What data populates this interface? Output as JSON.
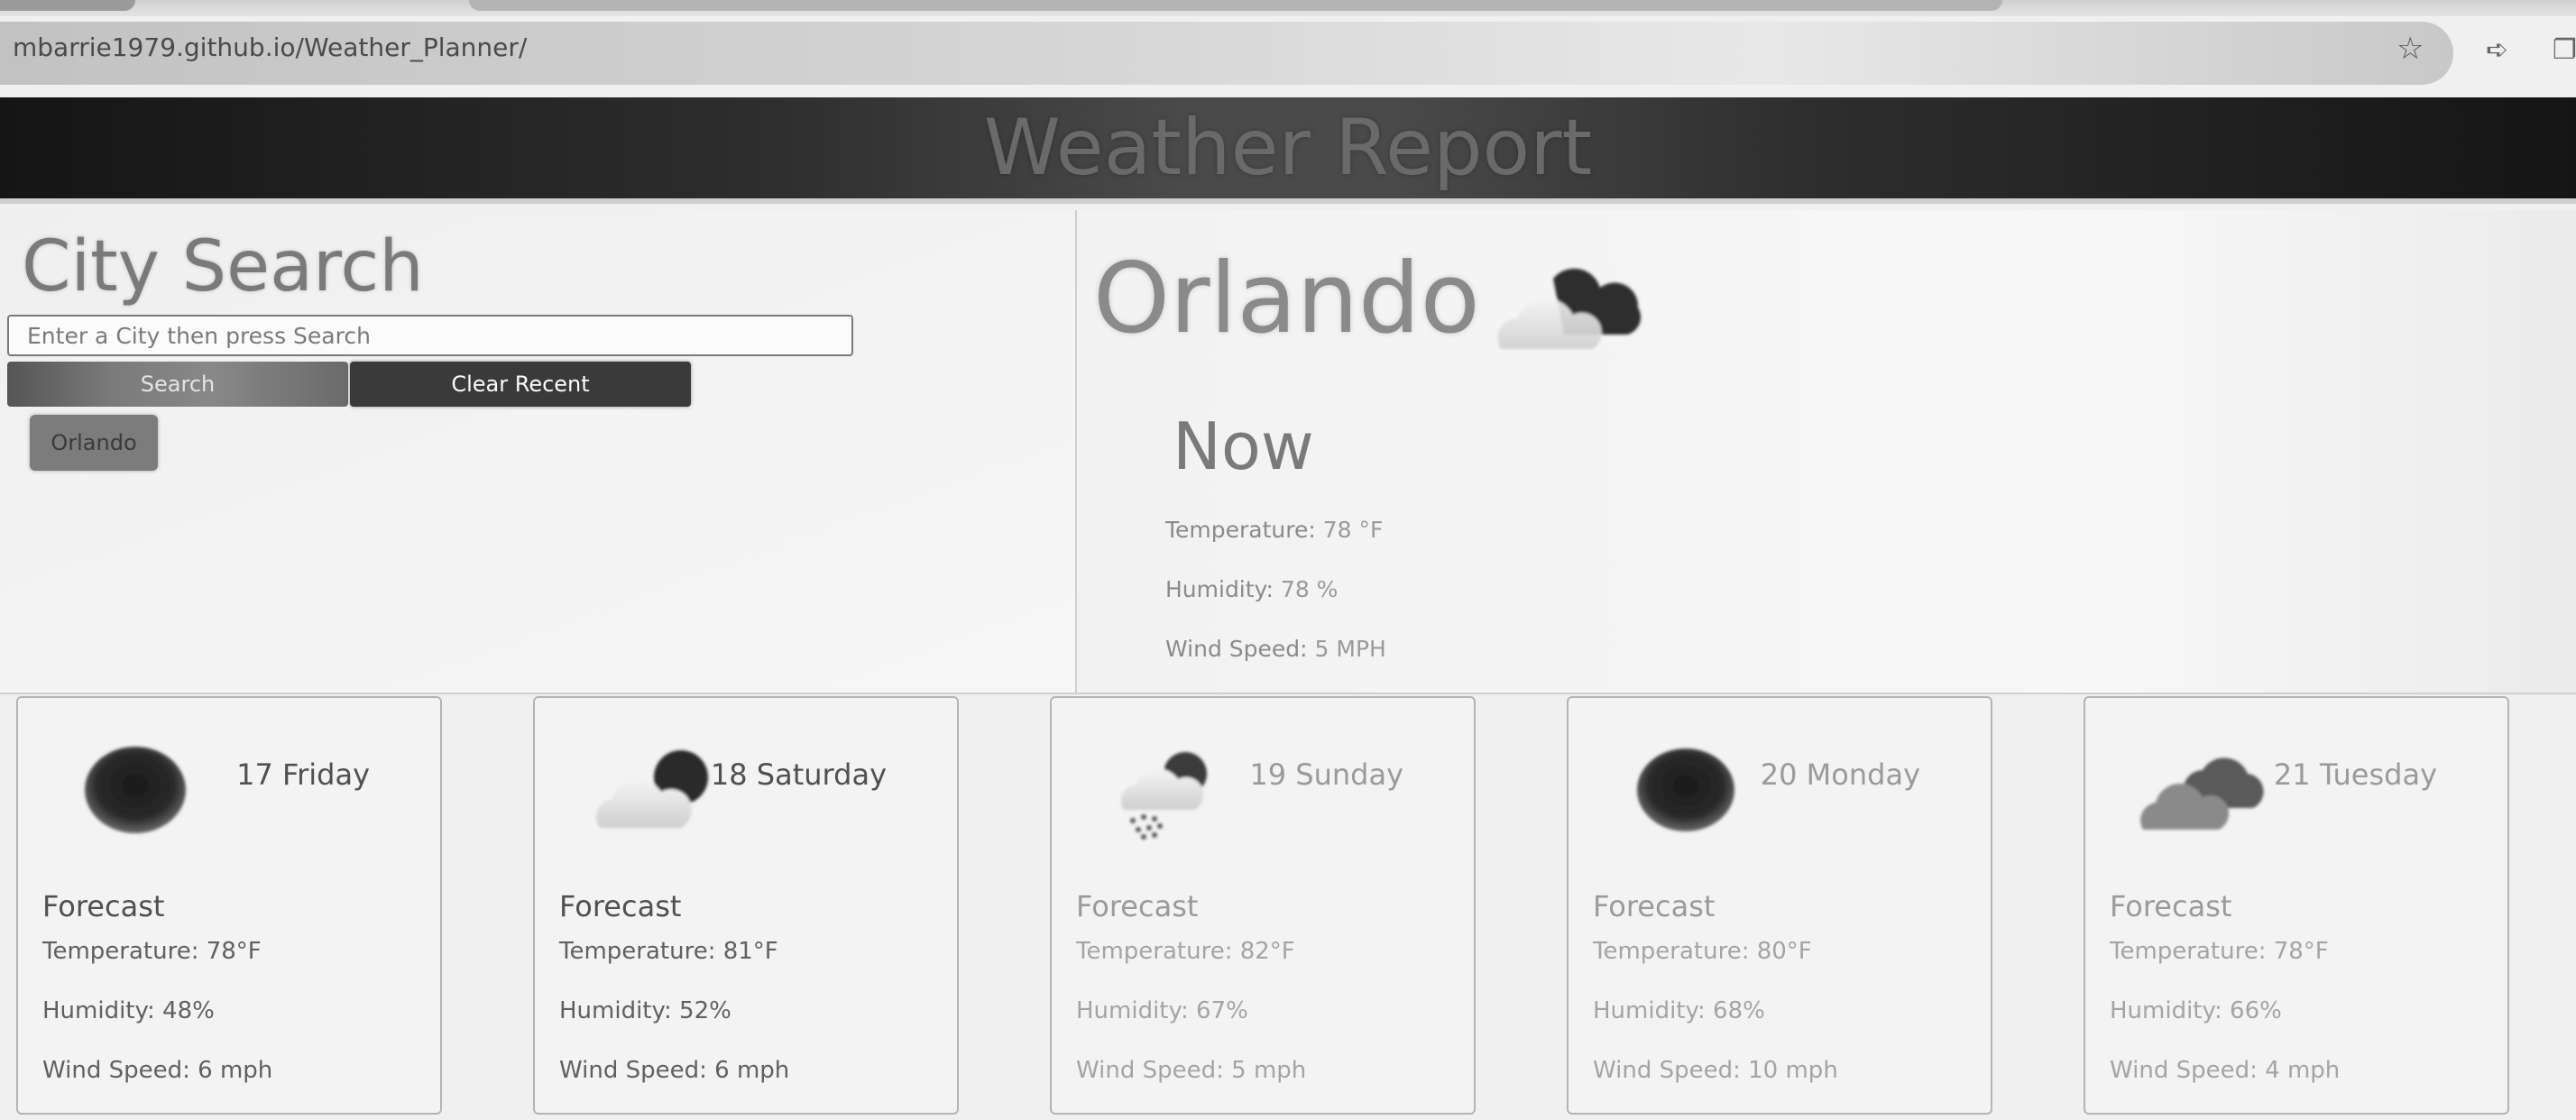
{
  "browser": {
    "url": "mbarrie1979.github.io/Weather_Planner/"
  },
  "header": {
    "title": "Weather Report"
  },
  "search": {
    "title": "City Search",
    "placeholder": "Enter a City then press Search",
    "search_label": "Search",
    "clear_label": "Clear Recent",
    "recent": [
      "Orlando"
    ]
  },
  "current": {
    "city": "Orlando",
    "icon": "partly-cloudy-night-icon",
    "now_label": "Now",
    "temperature_label": "Temperature:",
    "temperature_value": "78 °F",
    "humidity_label": "Humidity:",
    "humidity_value": "78 %",
    "wind_label": "Wind Speed:",
    "wind_value": "5 MPH"
  },
  "forecast": [
    {
      "date": "17 Friday",
      "icon": "moon-icon",
      "title": "Forecast",
      "temperature": "Temperature: 78°F",
      "humidity": "Humidity: 48%",
      "wind": "Wind Speed: 6 mph"
    },
    {
      "date": "18 Saturday",
      "icon": "partly-cloudy-night-icon",
      "title": "Forecast",
      "temperature": "Temperature: 81°F",
      "humidity": "Humidity: 52%",
      "wind": "Wind Speed: 6 mph"
    },
    {
      "date": "19 Sunday",
      "icon": "rain-night-icon",
      "title": "Forecast",
      "temperature": "Temperature: 82°F",
      "humidity": "Humidity: 67%",
      "wind": "Wind Speed: 5 mph"
    },
    {
      "date": "20 Monday",
      "icon": "moon-icon",
      "title": "Forecast",
      "temperature": "Temperature: 80°F",
      "humidity": "Humidity: 68%",
      "wind": "Wind Speed: 10 mph"
    },
    {
      "date": "21 Tuesday",
      "icon": "broken-clouds-icon",
      "title": "Forecast",
      "temperature": "Temperature: 78°F",
      "humidity": "Humidity: 66%",
      "wind": "Wind Speed: 4 mph"
    }
  ]
}
